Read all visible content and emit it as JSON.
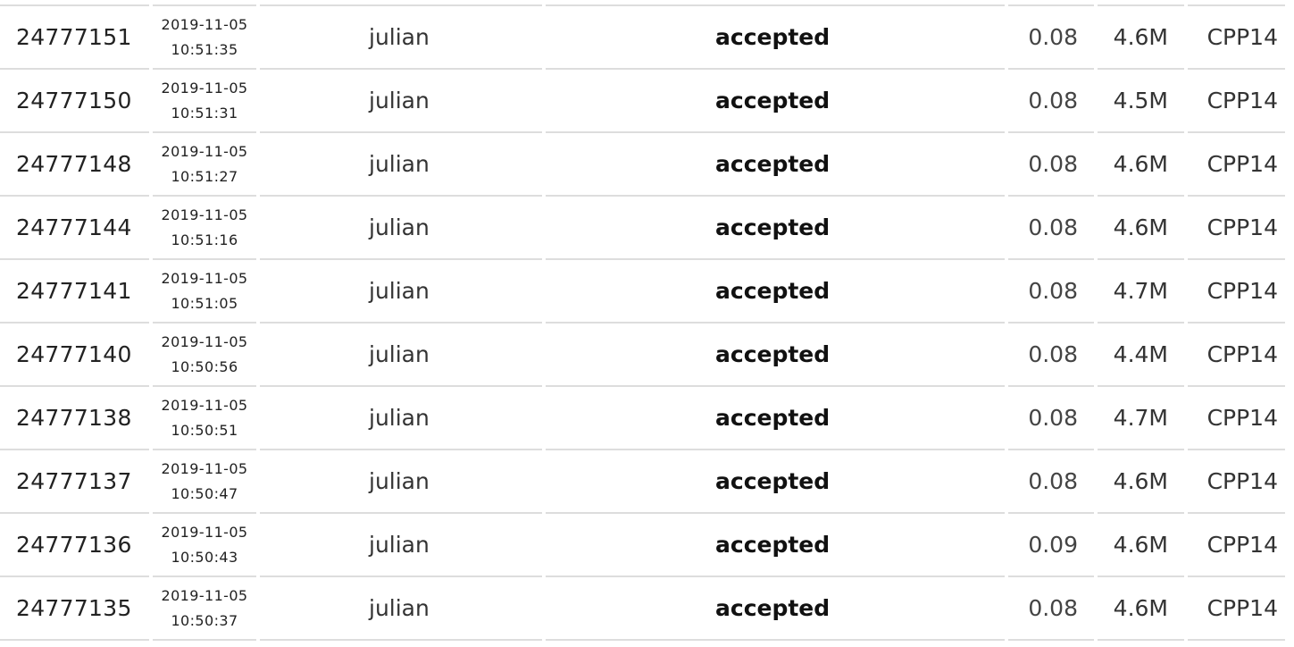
{
  "submissions": {
    "rows": [
      {
        "id": "24777151",
        "date": "2019-11-05",
        "time": "10:51:35",
        "user": "julian",
        "status": "accepted",
        "cpu": "0.08",
        "memory": "4.6M",
        "language": "CPP14"
      },
      {
        "id": "24777150",
        "date": "2019-11-05",
        "time": "10:51:31",
        "user": "julian",
        "status": "accepted",
        "cpu": "0.08",
        "memory": "4.5M",
        "language": "CPP14"
      },
      {
        "id": "24777148",
        "date": "2019-11-05",
        "time": "10:51:27",
        "user": "julian",
        "status": "accepted",
        "cpu": "0.08",
        "memory": "4.6M",
        "language": "CPP14"
      },
      {
        "id": "24777144",
        "date": "2019-11-05",
        "time": "10:51:16",
        "user": "julian",
        "status": "accepted",
        "cpu": "0.08",
        "memory": "4.6M",
        "language": "CPP14"
      },
      {
        "id": "24777141",
        "date": "2019-11-05",
        "time": "10:51:05",
        "user": "julian",
        "status": "accepted",
        "cpu": "0.08",
        "memory": "4.7M",
        "language": "CPP14"
      },
      {
        "id": "24777140",
        "date": "2019-11-05",
        "time": "10:50:56",
        "user": "julian",
        "status": "accepted",
        "cpu": "0.08",
        "memory": "4.4M",
        "language": "CPP14"
      },
      {
        "id": "24777138",
        "date": "2019-11-05",
        "time": "10:50:51",
        "user": "julian",
        "status": "accepted",
        "cpu": "0.08",
        "memory": "4.7M",
        "language": "CPP14"
      },
      {
        "id": "24777137",
        "date": "2019-11-05",
        "time": "10:50:47",
        "user": "julian",
        "status": "accepted",
        "cpu": "0.08",
        "memory": "4.6M",
        "language": "CPP14"
      },
      {
        "id": "24777136",
        "date": "2019-11-05",
        "time": "10:50:43",
        "user": "julian",
        "status": "accepted",
        "cpu": "0.09",
        "memory": "4.6M",
        "language": "CPP14"
      },
      {
        "id": "24777135",
        "date": "2019-11-05",
        "time": "10:50:37",
        "user": "julian",
        "status": "accepted",
        "cpu": "0.08",
        "memory": "4.6M",
        "language": "CPP14"
      }
    ]
  }
}
